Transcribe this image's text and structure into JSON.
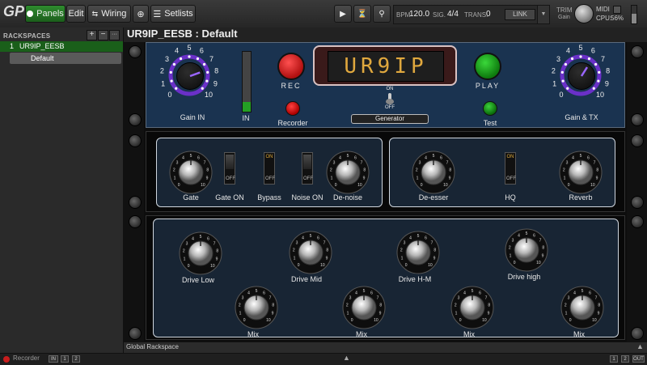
{
  "toolbar": {
    "logo": "GP",
    "panels": "Panels",
    "edit": "Edit",
    "wiring": "Wiring",
    "setlists": "Setlists",
    "bpm_label": "BPM",
    "bpm_value": "120.0",
    "sig_label": "SIG.",
    "sig_value": "4/4",
    "trans_label": "TRANS.",
    "trans_value": "0",
    "link": "LINK",
    "trim_label": "TRIM",
    "trim_sub": "Gain",
    "midi_label": "MIDI",
    "cpu_label": "CPU:",
    "cpu_value": "56%"
  },
  "sidebar": {
    "header": "RACKSPACES",
    "add": "+",
    "remove": "−",
    "more": "···",
    "rackspace": {
      "index": "1",
      "name": "UR9IP_EESB"
    },
    "variation": "Default"
  },
  "title": "UR9IP_EESB : Default",
  "unit1": {
    "gain_in": {
      "label": "Gain IN",
      "ticks": [
        "0",
        "1",
        "2",
        "3",
        "4",
        "5",
        "6",
        "7",
        "8",
        "9",
        "10"
      ]
    },
    "in_meter": {
      "label": "IN",
      "level": 0.16
    },
    "rec": "REC",
    "recorder": "Recorder",
    "display": "UR9IP",
    "gen_on": "ON",
    "gen_off": "OFF",
    "generator": "Generator",
    "play": "PLAY",
    "test": "Test",
    "gain_tx": {
      "label": "Gain &  TX",
      "ticks": [
        "0",
        "1",
        "2",
        "3",
        "4",
        "5",
        "6",
        "7",
        "8",
        "9",
        "10"
      ]
    }
  },
  "unit2": {
    "gate": "Gate",
    "gate_on": "Gate ON",
    "bypass": "Bypass",
    "noise_on": "Noise ON",
    "denoise": "De-noise",
    "deesser": "De-esser",
    "hq": "HQ",
    "reverb": "Reverb",
    "switch_on": "ON",
    "switch_off": "OFF"
  },
  "unit3": {
    "drive_low": "Drive Low",
    "drive_mid": "Drive Mid",
    "drive_hm": "Drive H-M",
    "drive_high": "Drive high",
    "mix": "Mix"
  },
  "global": "Global Rackspace",
  "status": {
    "recorder": "Recorder",
    "in": "IN",
    "one": "1",
    "two": "2",
    "out": "OUT"
  },
  "colors": {
    "green": "#2e8b2e",
    "purple": "#6a30c8",
    "red": "#c81d1d",
    "display_text": "#e0a83e",
    "panel": "#182534"
  }
}
